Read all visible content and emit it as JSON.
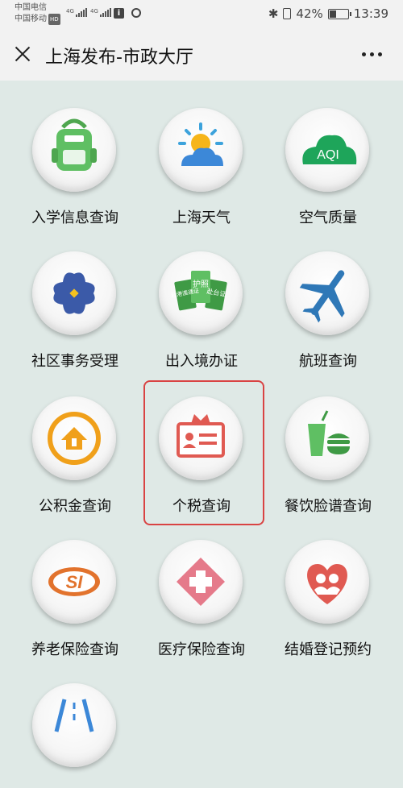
{
  "status_bar": {
    "carrier1": "中国电信",
    "carrier2": "中国移动",
    "hd_badge": "HD",
    "signal1_label": "4G",
    "signal2_label": "4G",
    "battery_percent": "42%",
    "battery_level": 0.42,
    "time": "13:39"
  },
  "nav": {
    "title": "上海发布-市政大厅"
  },
  "services": [
    {
      "label": "入学信息查询",
      "icon": "backpack-icon"
    },
    {
      "label": "上海天气",
      "icon": "weather-icon"
    },
    {
      "label": "空气质量",
      "icon": "aqi-cloud-icon",
      "icon_text": "AQI"
    },
    {
      "label": "社区事务受理",
      "icon": "community-icon"
    },
    {
      "label": "出入境办证",
      "icon": "passport-cards-icon",
      "icon_text_left": "赴港澳通证",
      "icon_text_mid": "护照",
      "icon_text_right": "赴台证"
    },
    {
      "label": "航班查询",
      "icon": "airplane-icon"
    },
    {
      "label": "公积金查询",
      "icon": "house-fund-icon"
    },
    {
      "label": "个税查询",
      "icon": "tax-card-icon"
    },
    {
      "label": "餐饮脸谱查询",
      "icon": "food-drink-icon"
    },
    {
      "label": "养老保险查询",
      "icon": "si-logo-icon",
      "icon_text": "SI"
    },
    {
      "label": "医疗保险查询",
      "icon": "medical-cross-icon"
    },
    {
      "label": "结婚登记预约",
      "icon": "wedding-heart-icon"
    },
    {
      "label": "",
      "icon": "road-icon"
    }
  ],
  "colors": {
    "background": "#dfe9e6",
    "highlight_border": "#d94343",
    "green": "#5fbf63",
    "blue": "#3c88d8",
    "orange": "#f0a01a",
    "red": "#e05a52"
  }
}
